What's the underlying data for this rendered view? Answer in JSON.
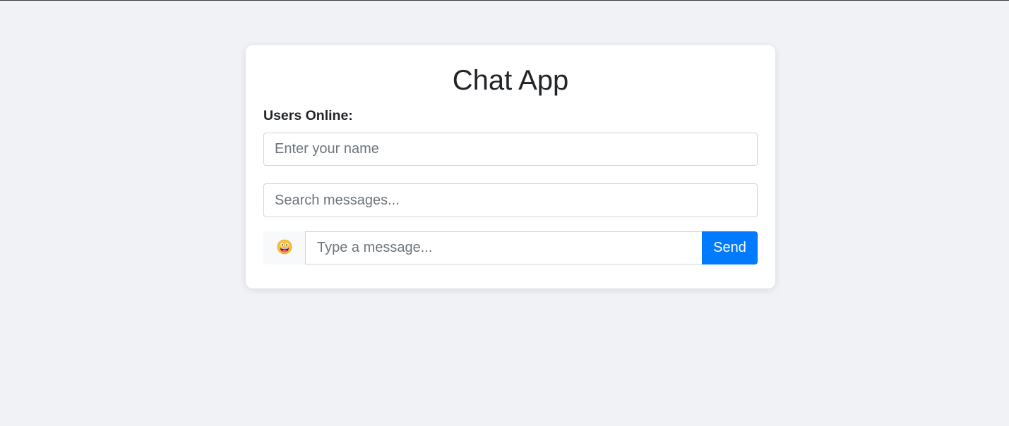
{
  "app": {
    "title": "Chat App",
    "users_online_label": "Users Online:"
  },
  "name_input": {
    "value": "",
    "placeholder": "Enter your name"
  },
  "search_input": {
    "value": "",
    "placeholder": "Search messages..."
  },
  "composer": {
    "emoji_icon": "grinning-face-with-tongue-icon",
    "message_placeholder": "Type a message...",
    "message_value": "",
    "send_label": "Send"
  },
  "colors": {
    "page_background": "#f0f2f5",
    "card_background": "#ffffff",
    "accent": "#007bff"
  }
}
